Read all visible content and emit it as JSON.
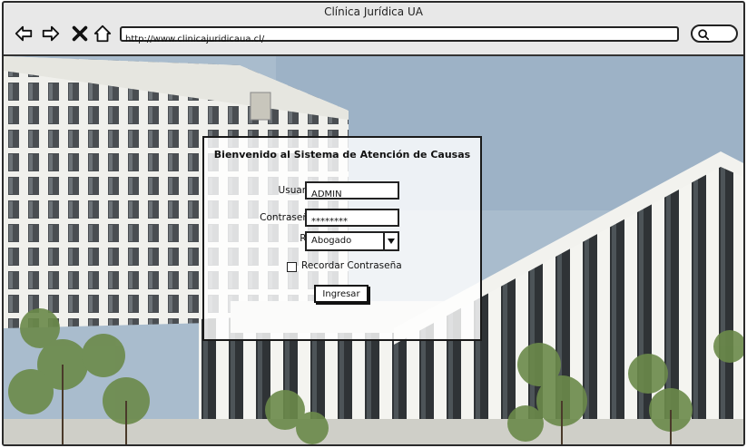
{
  "window": {
    "title": "Clínica Jurídica UA"
  },
  "toolbar": {
    "back_icon": "arrow-left-icon",
    "forward_icon": "arrow-right-icon",
    "stop_icon": "close-icon",
    "home_icon": "home-icon",
    "url": "http://www.clinicajuridicaua.cl/",
    "search_icon": "search-icon"
  },
  "login": {
    "title": "Bienvenido al Sistema de Atención de Causas",
    "user_label": "Usuario:",
    "user_value": "ADMIN",
    "password_label": "Contraseña:",
    "password_value": "********",
    "role_label": "Rol:",
    "role_value": "Abogado",
    "remember_label": "Recordar Contraseña",
    "remember_checked": false,
    "submit_label": "Ingresar"
  },
  "colors": {
    "frame": "#2b2b2b",
    "chrome_bg": "#e8e8e8",
    "building": "#f2f2ee",
    "window_dark": "#3a3d40",
    "tree": "#6b8a4a"
  }
}
